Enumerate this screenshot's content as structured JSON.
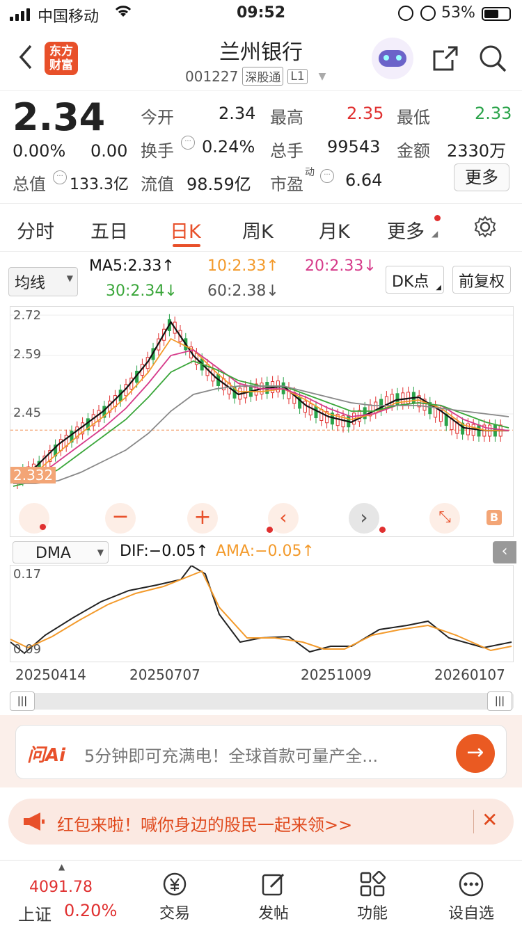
{
  "status_bar": {
    "carrier": "中国移动",
    "time": "09:52",
    "battery": "53%"
  },
  "header": {
    "logo_text": "东方财富",
    "stock_name": "兰州银行",
    "stock_code": "001227",
    "market_tag": "深股通",
    "level_tag": "L1"
  },
  "quote": {
    "price": "2.34",
    "change_pct": "0.00%",
    "change_amt": "0.00",
    "total_value_label": "总值",
    "total_value": "133.3亿",
    "fields": [
      {
        "label": "今开",
        "value": "2.34"
      },
      {
        "label": "最高",
        "value": "2.35"
      },
      {
        "label": "最低",
        "value": "2.33"
      },
      {
        "label": "换手",
        "value": "0.24%"
      },
      {
        "label": "总手",
        "value": "99543"
      },
      {
        "label": "金额",
        "value": "2330万"
      },
      {
        "label": "流值",
        "value": "98.59亿"
      },
      {
        "label": "市盈",
        "value": "6.64"
      }
    ],
    "pe_super": "动",
    "more_button": "更多"
  },
  "tabs": [
    "分时",
    "五日",
    "日K",
    "周K",
    "月K",
    "更多"
  ],
  "ma_bar": {
    "selector": "均线",
    "ma5": "MA5:2.33↑",
    "ma10": "10:2.33↑",
    "ma20": "20:2.33↓",
    "ma30": "30:2.34↓",
    "ma60": "60:2.38↓",
    "dk_button": "DK点",
    "adjust_button": "前复权"
  },
  "colors": {
    "accent": "#e8502a",
    "up": "#e03030",
    "down": "#2aa34a",
    "ma5": "#111111",
    "ma10": "#f39a2b",
    "ma20": "#d63a8a",
    "ma30": "#3aa63a",
    "ma60": "#888888"
  },
  "chart_data": {
    "type": "line",
    "y_ticks": [
      "2.72",
      "2.59",
      "2.45",
      "2.332"
    ],
    "current_price_label": "2.332",
    "x_labels": [
      "20250414",
      "20250707",
      "20251009",
      "20260107"
    ],
    "series": [
      {
        "name": "MA5",
        "values": [
          2.16,
          2.2,
          2.28,
          2.34,
          2.4,
          2.48,
          2.58,
          2.72,
          2.6,
          2.52,
          2.46,
          2.48,
          2.49,
          2.42,
          2.38,
          2.36,
          2.4,
          2.44,
          2.45,
          2.4,
          2.34,
          2.33,
          2.33
        ]
      },
      {
        "name": "10",
        "values": [
          2.15,
          2.18,
          2.25,
          2.32,
          2.38,
          2.45,
          2.54,
          2.66,
          2.62,
          2.54,
          2.47,
          2.47,
          2.48,
          2.44,
          2.39,
          2.37,
          2.39,
          2.43,
          2.44,
          2.41,
          2.35,
          2.33,
          2.33
        ]
      },
      {
        "name": "20",
        "values": [
          2.14,
          2.16,
          2.22,
          2.28,
          2.34,
          2.41,
          2.5,
          2.6,
          2.62,
          2.56,
          2.5,
          2.48,
          2.48,
          2.45,
          2.41,
          2.38,
          2.39,
          2.42,
          2.43,
          2.42,
          2.37,
          2.34,
          2.33
        ]
      },
      {
        "name": "30",
        "values": [
          2.13,
          2.15,
          2.19,
          2.25,
          2.31,
          2.37,
          2.45,
          2.54,
          2.58,
          2.55,
          2.51,
          2.49,
          2.49,
          2.46,
          2.43,
          2.4,
          2.4,
          2.42,
          2.43,
          2.42,
          2.39,
          2.36,
          2.34
        ]
      },
      {
        "name": "60",
        "values": [
          2.14,
          2.14,
          2.15,
          2.18,
          2.22,
          2.26,
          2.32,
          2.4,
          2.46,
          2.48,
          2.49,
          2.49,
          2.49,
          2.47,
          2.45,
          2.43,
          2.42,
          2.42,
          2.42,
          2.41,
          2.4,
          2.39,
          2.38
        ]
      }
    ],
    "ylim": [
      2.1,
      2.75
    ]
  },
  "sub_chart": {
    "selector": "DMA",
    "dif": "DIF:−0.05↑",
    "ama": "AMA:−0.05↑",
    "y_top": "0.17",
    "y_bottom": "0.09"
  },
  "ai_bar": {
    "brand": "问Ai",
    "text": "5分钟即可充满电！全球首款可量产全..."
  },
  "promo": {
    "text": "红包来啦！喊你身边的股民一起来领>>"
  },
  "bottom_nav": {
    "index_value": "4091.78",
    "index_name": "上证",
    "index_change": "0.20%",
    "items": [
      "交易",
      "发帖",
      "功能",
      "设自选"
    ]
  }
}
